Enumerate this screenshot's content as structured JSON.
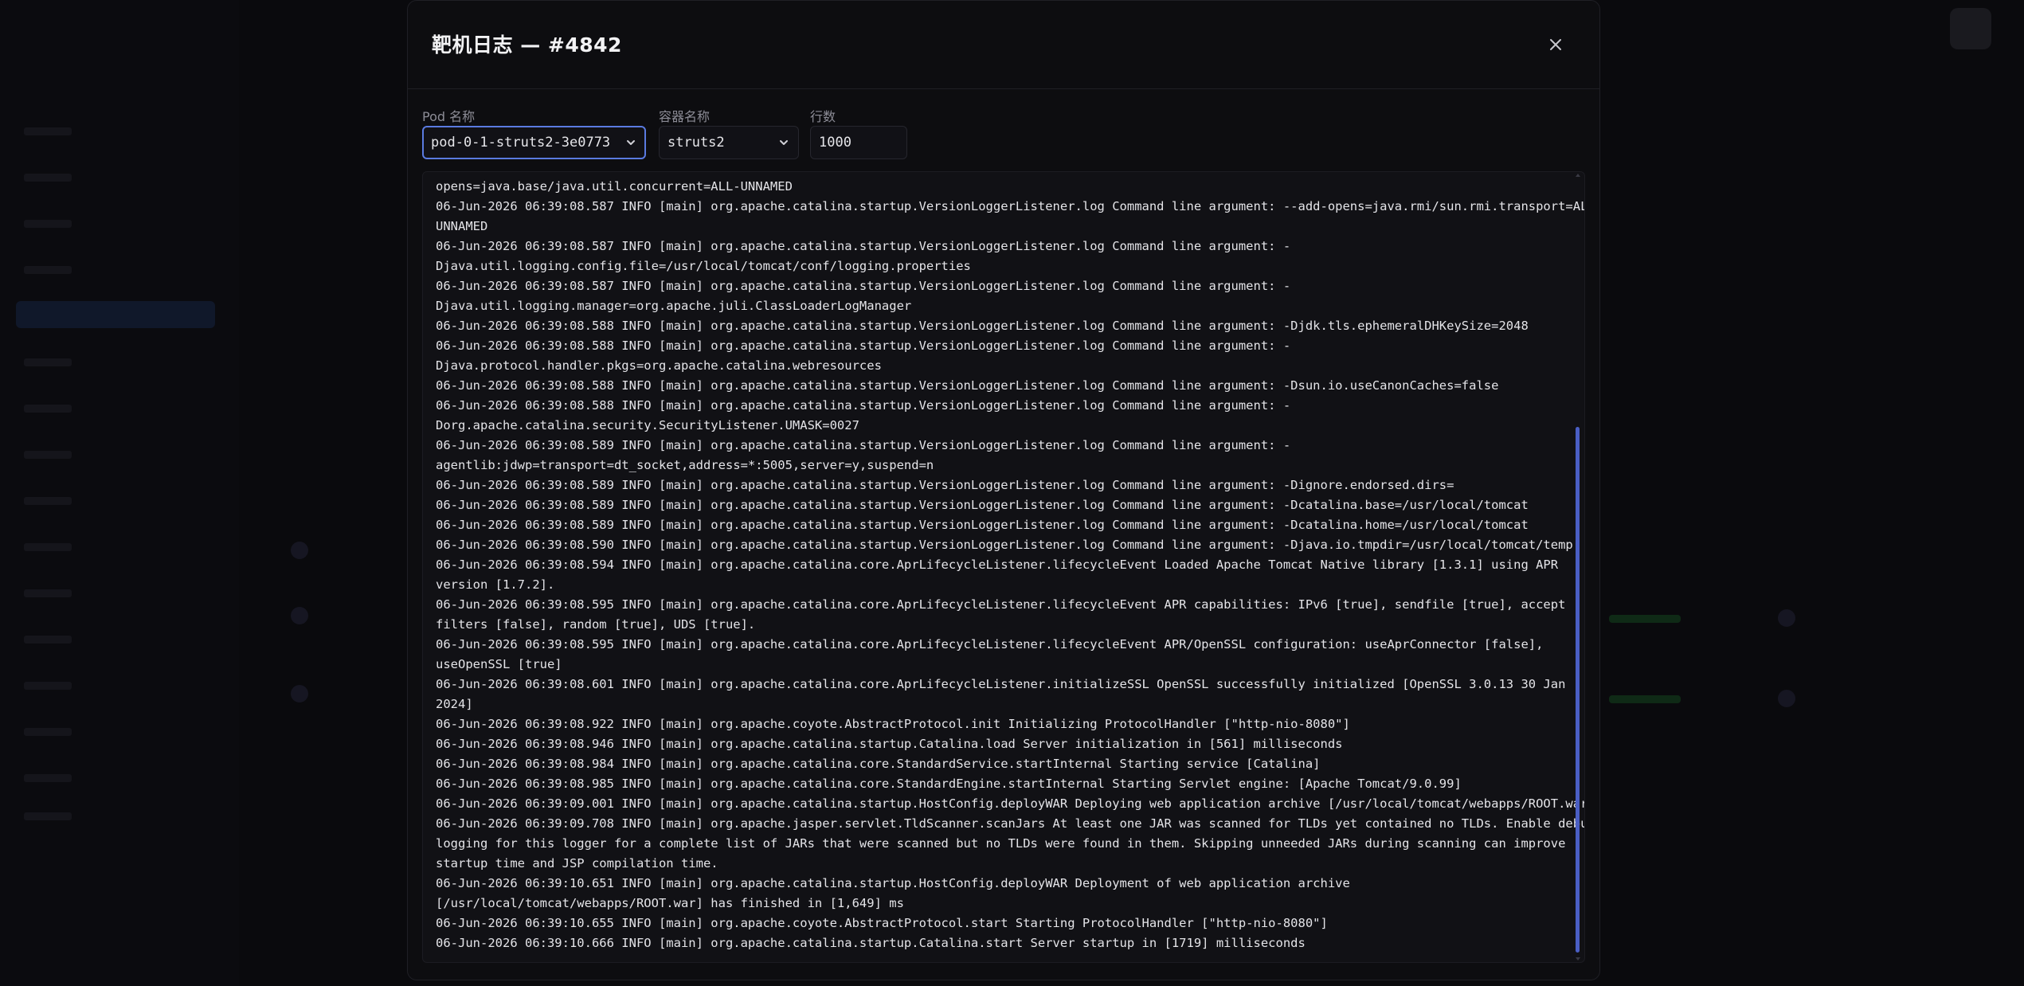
{
  "modal": {
    "title": "靶机日志 — #4842",
    "close_icon": "close-icon"
  },
  "filters": {
    "pod_label": "Pod 名称",
    "pod_value": "pod-0-1-struts2-3e0773",
    "container_label": "容器名称",
    "container_value": "struts2",
    "lines_label": "行数",
    "lines_value": "1000"
  },
  "colors": {
    "accent": "#5a7ae0",
    "scrollbar": "#4a5ec4",
    "text": "#e4e4e8",
    "background": "#0d0d10"
  },
  "log_lines": [
    "opens=java.base/java.util.concurrent=ALL-UNNAMED",
    "06-Jun-2026 06:39:08.587 INFO [main] org.apache.catalina.startup.VersionLoggerListener.log Command line argument: --add-opens=java.rmi/sun.rmi.transport=ALL-",
    "UNNAMED",
    "06-Jun-2026 06:39:08.587 INFO [main] org.apache.catalina.startup.VersionLoggerListener.log Command line argument: -",
    "Djava.util.logging.config.file=/usr/local/tomcat/conf/logging.properties",
    "06-Jun-2026 06:39:08.587 INFO [main] org.apache.catalina.startup.VersionLoggerListener.log Command line argument: -",
    "Djava.util.logging.manager=org.apache.juli.ClassLoaderLogManager",
    "06-Jun-2026 06:39:08.588 INFO [main] org.apache.catalina.startup.VersionLoggerListener.log Command line argument: -Djdk.tls.ephemeralDHKeySize=2048",
    "06-Jun-2026 06:39:08.588 INFO [main] org.apache.catalina.startup.VersionLoggerListener.log Command line argument: -",
    "Djava.protocol.handler.pkgs=org.apache.catalina.webresources",
    "06-Jun-2026 06:39:08.588 INFO [main] org.apache.catalina.startup.VersionLoggerListener.log Command line argument: -Dsun.io.useCanonCaches=false",
    "06-Jun-2026 06:39:08.588 INFO [main] org.apache.catalina.startup.VersionLoggerListener.log Command line argument: -",
    "Dorg.apache.catalina.security.SecurityListener.UMASK=0027",
    "06-Jun-2026 06:39:08.589 INFO [main] org.apache.catalina.startup.VersionLoggerListener.log Command line argument: -",
    "agentlib:jdwp=transport=dt_socket,address=*:5005,server=y,suspend=n",
    "06-Jun-2026 06:39:08.589 INFO [main] org.apache.catalina.startup.VersionLoggerListener.log Command line argument: -Dignore.endorsed.dirs=",
    "06-Jun-2026 06:39:08.589 INFO [main] org.apache.catalina.startup.VersionLoggerListener.log Command line argument: -Dcatalina.base=/usr/local/tomcat",
    "06-Jun-2026 06:39:08.589 INFO [main] org.apache.catalina.startup.VersionLoggerListener.log Command line argument: -Dcatalina.home=/usr/local/tomcat",
    "06-Jun-2026 06:39:08.590 INFO [main] org.apache.catalina.startup.VersionLoggerListener.log Command line argument: -Djava.io.tmpdir=/usr/local/tomcat/temp",
    "06-Jun-2026 06:39:08.594 INFO [main] org.apache.catalina.core.AprLifecycleListener.lifecycleEvent Loaded Apache Tomcat Native library [1.3.1] using APR",
    "version [1.7.2].",
    "06-Jun-2026 06:39:08.595 INFO [main] org.apache.catalina.core.AprLifecycleListener.lifecycleEvent APR capabilities: IPv6 [true], sendfile [true], accept",
    "filters [false], random [true], UDS [true].",
    "06-Jun-2026 06:39:08.595 INFO [main] org.apache.catalina.core.AprLifecycleListener.lifecycleEvent APR/OpenSSL configuration: useAprConnector [false],",
    "useOpenSSL [true]",
    "06-Jun-2026 06:39:08.601 INFO [main] org.apache.catalina.core.AprLifecycleListener.initializeSSL OpenSSL successfully initialized [OpenSSL 3.0.13 30 Jan",
    "2024]",
    "06-Jun-2026 06:39:08.922 INFO [main] org.apache.coyote.AbstractProtocol.init Initializing ProtocolHandler [\"http-nio-8080\"]",
    "06-Jun-2026 06:39:08.946 INFO [main] org.apache.catalina.startup.Catalina.load Server initialization in [561] milliseconds",
    "06-Jun-2026 06:39:08.984 INFO [main] org.apache.catalina.core.StandardService.startInternal Starting service [Catalina]",
    "06-Jun-2026 06:39:08.985 INFO [main] org.apache.catalina.core.StandardEngine.startInternal Starting Servlet engine: [Apache Tomcat/9.0.99]",
    "06-Jun-2026 06:39:09.001 INFO [main] org.apache.catalina.startup.HostConfig.deployWAR Deploying web application archive [/usr/local/tomcat/webapps/ROOT.war]",
    "06-Jun-2026 06:39:09.708 INFO [main] org.apache.jasper.servlet.TldScanner.scanJars At least one JAR was scanned for TLDs yet contained no TLDs. Enable debug",
    "logging for this logger for a complete list of JARs that were scanned but no TLDs were found in them. Skipping unneeded JARs during scanning can improve",
    "startup time and JSP compilation time.",
    "06-Jun-2026 06:39:10.651 INFO [main] org.apache.catalina.startup.HostConfig.deployWAR Deployment of web application archive",
    "[/usr/local/tomcat/webapps/ROOT.war] has finished in [1,649] ms",
    "06-Jun-2026 06:39:10.655 INFO [main] org.apache.coyote.AbstractProtocol.start Starting ProtocolHandler [\"http-nio-8080\"]",
    "06-Jun-2026 06:39:10.666 INFO [main] org.apache.catalina.startup.Catalina.start Server startup in [1719] milliseconds"
  ]
}
